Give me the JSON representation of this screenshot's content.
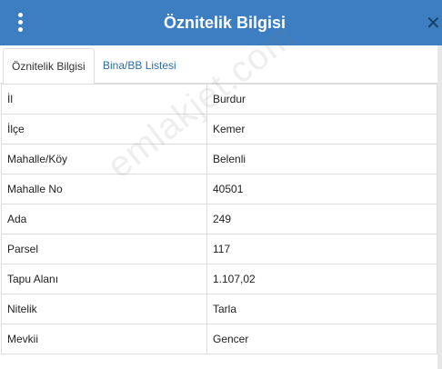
{
  "header": {
    "title": "Öznitelik Bilgisi",
    "close_glyph": "✕",
    "background_color": "#3c7ec1",
    "menu_icon": "vertical-ellipsis-icon",
    "close_icon": "close-icon"
  },
  "tabs": [
    {
      "label": "Öznitelik Bilgisi",
      "active": true
    },
    {
      "label": "Bina/BB Listesi",
      "active": false
    }
  ],
  "rows": [
    {
      "key": "İl",
      "value": "Burdur"
    },
    {
      "key": "İlçe",
      "value": "Kemer"
    },
    {
      "key": "Mahalle/Köy",
      "value": "Belenli"
    },
    {
      "key": "Mahalle No",
      "value": "40501"
    },
    {
      "key": "Ada",
      "value": "249"
    },
    {
      "key": "Parsel",
      "value": "117"
    },
    {
      "key": "Tapu Alanı",
      "value": "1.107,02"
    },
    {
      "key": "Nitelik",
      "value": "Tarla"
    },
    {
      "key": "Mevkii",
      "value": "Gencer"
    }
  ],
  "watermark": "emlakjet.com"
}
